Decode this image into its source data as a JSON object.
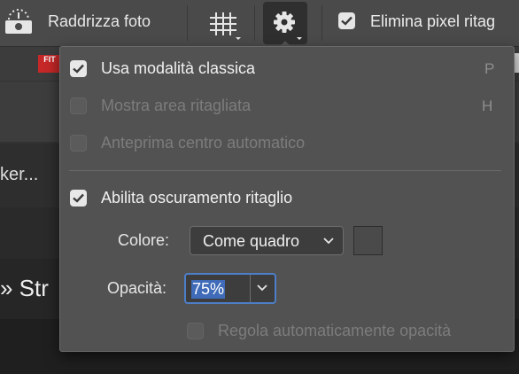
{
  "options_bar": {
    "straighten_label": "Raddrizza foto",
    "delete_pixels_label": "Elimina pixel ritag",
    "delete_pixels_checked": true,
    "grid_overlay_icon": "grid-overlay-icon",
    "settings_icon": "gear-icon"
  },
  "background": {
    "tab_icon_text": "FIT",
    "field_text": "ker...",
    "heading_text": "» Str"
  },
  "popover": {
    "options": [
      {
        "label": "Usa modalità classica",
        "shortcut": "P",
        "checked": true,
        "enabled": true
      },
      {
        "label": "Mostra area ritagliata",
        "shortcut": "H",
        "checked": false,
        "enabled": false
      },
      {
        "label": "Anteprima centro automatico",
        "shortcut": "",
        "checked": false,
        "enabled": false
      }
    ],
    "shield": {
      "label": "Abilita oscuramento ritaglio",
      "checked": true
    },
    "color": {
      "label": "Colore:",
      "value": "Come quadro",
      "swatch": "#4a4a4a"
    },
    "opacity": {
      "label": "Opacità:",
      "value": "75%"
    },
    "auto_opacity": {
      "label": "Regola automaticamente opacità",
      "checked": false,
      "enabled": false
    }
  },
  "colors": {
    "accent_focus": "#4d7ec8",
    "selection": "#3f6bb8",
    "popover_bg": "#525252"
  }
}
